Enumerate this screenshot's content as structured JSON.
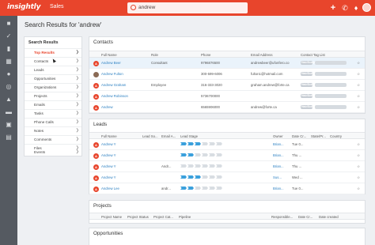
{
  "app": {
    "logo": "insightly",
    "name": "Sales",
    "search_value": "andrew",
    "colors": {
      "brand": "#e8452c",
      "link": "#2a7fc1",
      "stage_active": "#3aa0dc"
    }
  },
  "topbar_icons": [
    "plus-icon",
    "phone-icon",
    "bell-icon",
    "user-avatar"
  ],
  "rail_icons": [
    "home-icon",
    "tasks-icon",
    "contacts-icon",
    "organizations-icon",
    "opportunities-icon",
    "leads-icon",
    "projects-icon",
    "emails-icon",
    "calendar-icon",
    "files-icon",
    "dashboard-icon",
    "reports-icon"
  ],
  "page_title": "Search Results for 'andrew'",
  "nav": {
    "heading": "Search Results",
    "items": [
      "Top Results",
      "Contacts",
      "Leads",
      "Opportunities",
      "Organizations",
      "Projects",
      "Emails",
      "Tasks",
      "Phone Calls",
      "Notes",
      "Comments",
      "Files",
      "Events"
    ],
    "active": "Top Results"
  },
  "contacts": {
    "title": "Contacts",
    "columns": [
      "Full Name",
      "Role",
      "Phone",
      "Email Address",
      "Contact Tag List"
    ],
    "rows": [
      {
        "name": "Andrew Beer",
        "role": "Consultant",
        "phone": "9796876500",
        "email": "andrewbeer@ufonfero.co",
        "tag": "Hair/Scalp"
      },
      {
        "name": "Andrew Fulton",
        "role": "",
        "phone": "300-599-6006",
        "email": "fulton1@hotmail.com",
        "tag": "Hair/Scalp"
      },
      {
        "name": "Andrew Graham",
        "role": "Employee",
        "phone": "316-333-3020",
        "email": "graham.andrew@forte.ca",
        "tag": "Hair/Scalp"
      },
      {
        "name": "Andrew Robinson",
        "role": "",
        "phone": "5736700000",
        "email": "",
        "tag": "Hair/Scalp"
      },
      {
        "name": "Andrew",
        "role": "",
        "phone": "6565906000",
        "email": "andrew@forte.ca",
        "tag": "Hair/Scalp"
      }
    ]
  },
  "leads": {
    "title": "Leads",
    "columns": [
      "Full Name",
      "Lead So...",
      "Email A...",
      "Lead Stage",
      "Owner",
      "Date Cr...",
      "State/Pr...",
      "Country"
    ],
    "rows": [
      {
        "name": "Andrew Y",
        "source": "",
        "email": "",
        "stage_active": 3,
        "stage_total": 6,
        "owner": "Brian...",
        "date": "Tue 0..."
      },
      {
        "name": "Andrew Y",
        "source": "",
        "email": "",
        "stage_active": 2,
        "stage_total": 6,
        "owner": "Brian...",
        "date": "Thu ..."
      },
      {
        "name": "Andrew Y",
        "source": "",
        "email": "Andr...",
        "stage_active": 0,
        "stage_total": 6,
        "owner": "Brian...",
        "date": "Thu ..."
      },
      {
        "name": "Andrew Y",
        "source": "",
        "email": "",
        "stage_active": 3,
        "stage_total": 6,
        "owner": "Sus...",
        "date": "Wed ..."
      },
      {
        "name": "Andrew Lee",
        "source": "",
        "email": "andr...",
        "stage_active": 2,
        "stage_total": 6,
        "owner": "Brian...",
        "date": "Tue 0..."
      }
    ]
  },
  "projects": {
    "title": "Projects",
    "columns": [
      "Project Name",
      "Project Status",
      "Project Cat...",
      "Pipeline",
      "Responsible...",
      "Date Cr...",
      "Date created"
    ]
  },
  "opportunities": {
    "title": "Opportunities"
  }
}
